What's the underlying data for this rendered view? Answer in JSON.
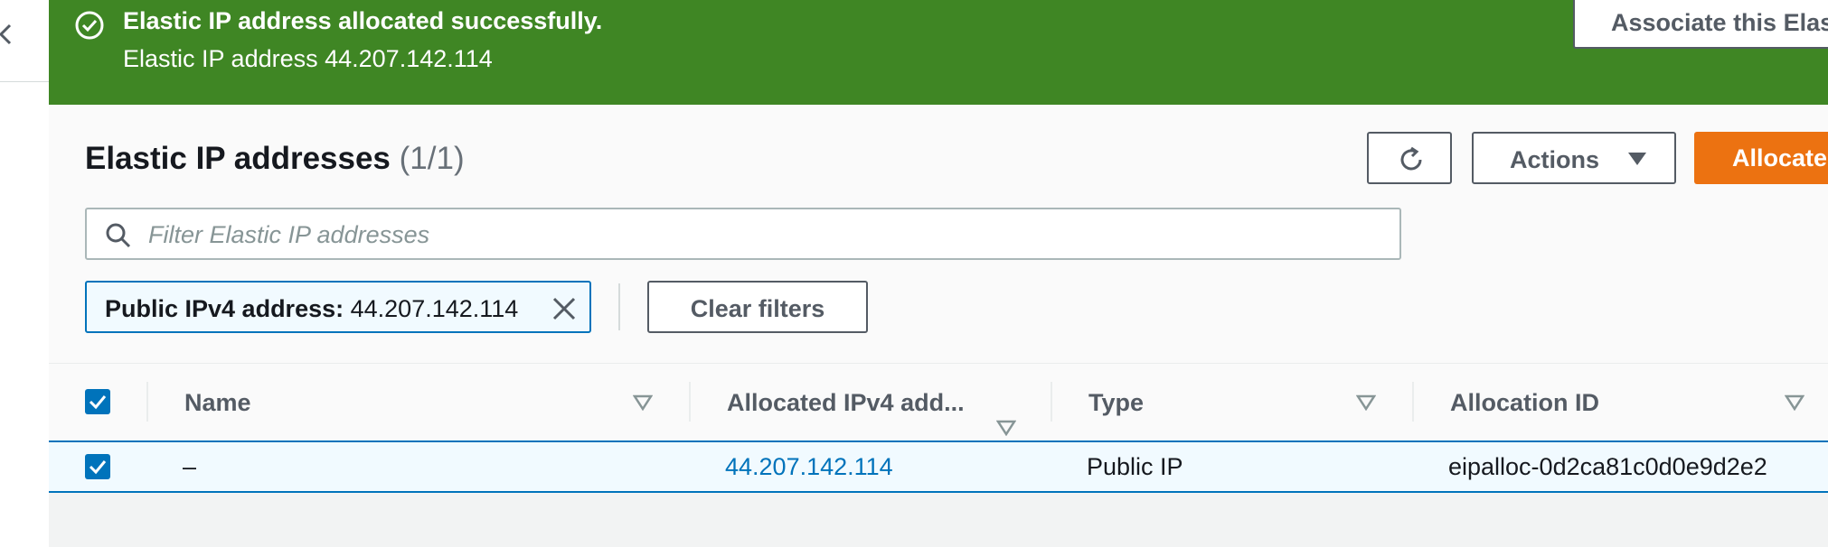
{
  "flash": {
    "title": "Elastic IP address allocated successfully.",
    "message": "Elastic IP address 44.207.142.114",
    "associate_label": "Associate this Elas"
  },
  "header": {
    "title": "Elastic IP addresses",
    "count": "(1/1)",
    "actions_label": "Actions",
    "allocate_label": "Allocate"
  },
  "search": {
    "placeholder": "Filter Elastic IP addresses",
    "value": ""
  },
  "filter_token": {
    "key": "Public IPv4 address:",
    "value": "44.207.142.114"
  },
  "clear_filters_label": "Clear filters",
  "table": {
    "columns": [
      "Name",
      "Allocated IPv4 add...",
      "Type",
      "Allocation ID"
    ],
    "rows": [
      {
        "name": "–",
        "ip": "44.207.142.114",
        "type": "Public IP",
        "allocation_id": "eipalloc-0d2ca81c0d0e9d2e2"
      }
    ]
  },
  "colors": {
    "success": "#3f8624",
    "primary": "#ec7211",
    "link": "#0073bb"
  }
}
